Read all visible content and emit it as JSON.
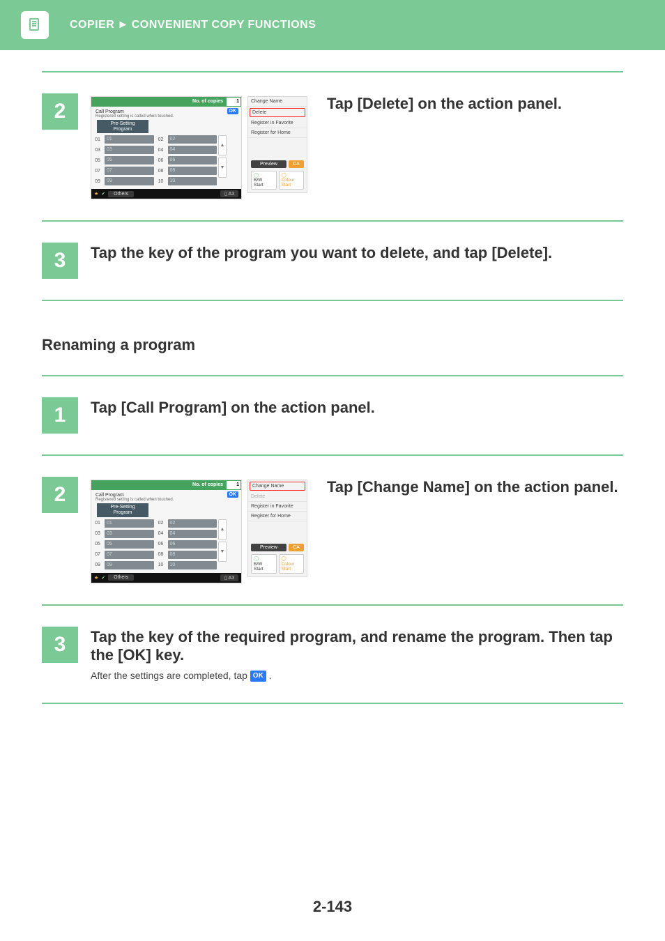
{
  "header": {
    "section": "COPIER",
    "subsection": "CONVENIENT COPY FUNCTIONS"
  },
  "page_number": "2-143",
  "section_title": "Renaming a program",
  "delete_steps": {
    "s2": {
      "num": "2",
      "title": "Tap [Delete] on the action panel.",
      "panel": {
        "copies_label": "No. of copies",
        "copies_value": "1",
        "call_program": "Call Program",
        "call_program_desc": "Registered setting is called when touched.",
        "presetting": "Pre-Setting\nProgram",
        "ok": "OK",
        "slots": [
          [
            "01",
            "01"
          ],
          [
            "02",
            "02"
          ],
          [
            "03",
            "03"
          ],
          [
            "04",
            "04"
          ],
          [
            "05",
            "05"
          ],
          [
            "06",
            "06"
          ],
          [
            "07",
            "07"
          ],
          [
            "08",
            "08"
          ],
          [
            "09",
            "09"
          ],
          [
            "10",
            "10"
          ]
        ],
        "footer_others": "Others",
        "footer_tray": "A3"
      },
      "side": {
        "change_name": "Change Name",
        "delete": "Delete",
        "reg_fav": "Register in Favorite",
        "reg_home": "Register for Home",
        "preview": "Preview",
        "ca": "CA",
        "bw": "B/W\nStart",
        "colour": "Colour\nStart"
      }
    },
    "s3": {
      "num": "3",
      "title": "Tap the key of the program you want to delete, and tap [Delete]."
    }
  },
  "rename_steps": {
    "s1": {
      "num": "1",
      "title": "Tap [Call Program] on the action panel."
    },
    "s2": {
      "num": "2",
      "title": "Tap [Change Name] on the action panel.",
      "side": {
        "change_name": "Change Name",
        "delete": "Delete",
        "reg_fav": "Register in Favorite",
        "reg_home": "Register for Home",
        "preview": "Preview",
        "ca": "CA",
        "bw": "B/W\nStart",
        "colour": "Colour\nStart"
      }
    },
    "s3": {
      "num": "3",
      "title": "Tap the key of the required program, and rename the program. Then tap the [OK] key.",
      "after_text_1": "After the settings are completed, tap ",
      "ok_badge": "OK",
      "after_text_2": " ."
    }
  }
}
